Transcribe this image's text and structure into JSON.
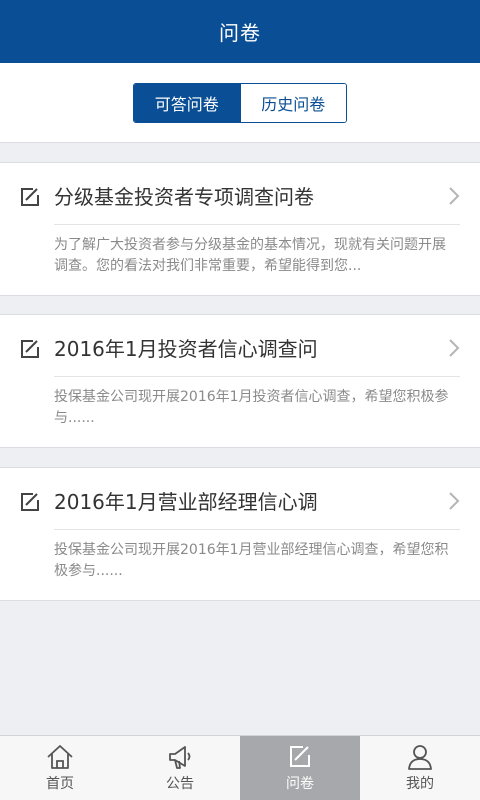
{
  "header": {
    "title": "问卷"
  },
  "segments": [
    {
      "label": "可答问卷",
      "active": true
    },
    {
      "label": "历史问卷",
      "active": false
    }
  ],
  "surveys": [
    {
      "title": "分级基金投资者专项调查问卷",
      "desc": "为了解广大投资者参与分级基金的基本情况，现就有关问题开展调查。您的看法对我们非常重要，希望能得到您..."
    },
    {
      "title": "2016年1月投资者信心调查问",
      "desc": "投保基金公司现开展2016年1月投资者信心调查，希望您积极参与......"
    },
    {
      "title": "2016年1月营业部经理信心调",
      "desc": "投保基金公司现开展2016年1月营业部经理信心调查，希望您积极参与......"
    }
  ],
  "tabbar": [
    {
      "label": "首页",
      "icon": "home-icon"
    },
    {
      "label": "公告",
      "icon": "megaphone-icon"
    },
    {
      "label": "问卷",
      "icon": "survey-icon",
      "selected": true
    },
    {
      "label": "我的",
      "icon": "user-icon"
    }
  ],
  "colors": {
    "primary": "#0a4f95",
    "background": "#eeeff3",
    "tab_selected": "#a7a8ab"
  }
}
